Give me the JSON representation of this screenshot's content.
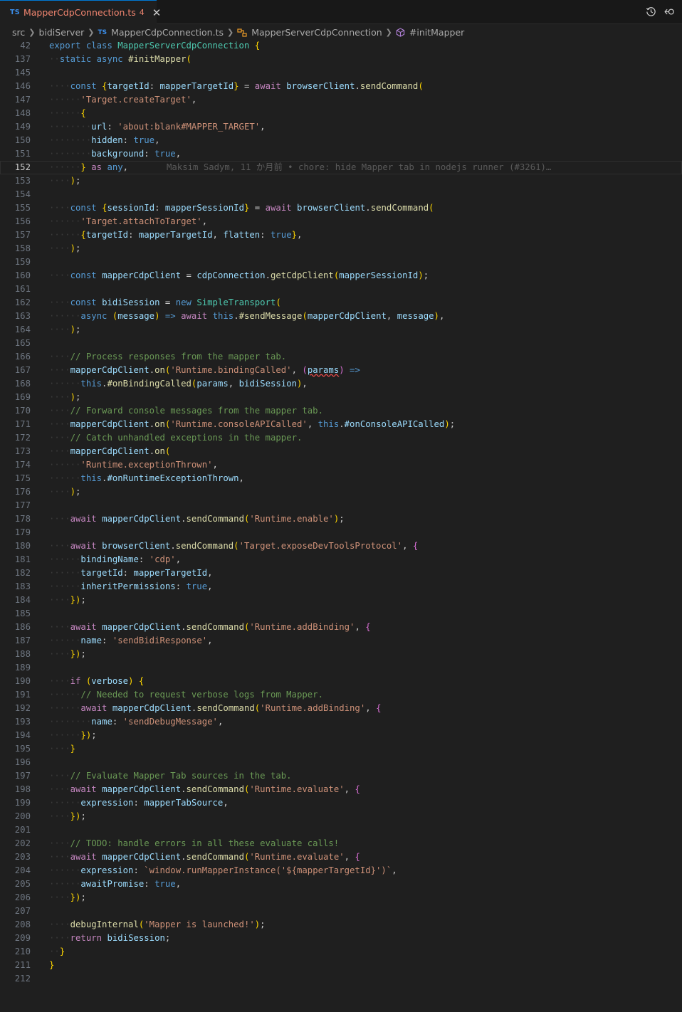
{
  "tab": {
    "lang_badge": "TS",
    "filename": "MapperCdpConnection.ts",
    "problem_count": "4",
    "close_glyph": "✕"
  },
  "toolbar": {
    "icons": [
      "history-icon",
      "go-back-icon"
    ]
  },
  "breadcrumb": {
    "items": [
      {
        "label": "src",
        "icon": ""
      },
      {
        "label": "bidiServer",
        "icon": ""
      },
      {
        "label": "MapperCdpConnection.ts",
        "icon": "typescript-file-icon"
      },
      {
        "label": "MapperServerCdpConnection",
        "icon": "class-icon"
      },
      {
        "label": "#initMapper",
        "icon": "method-icon"
      }
    ]
  },
  "editor": {
    "current_line": "152",
    "blame": "Maksim Sadym, 11 か月前 • chore: hide Mapper tab in nodejs runner (#3261)…",
    "lines": [
      {
        "n": "42",
        "t": "export class MapperServerCdpConnection {"
      },
      {
        "n": "137",
        "t": "  static async #initMapper("
      },
      {
        "n": "145",
        "t": ""
      },
      {
        "n": "146",
        "t": "    const {targetId: mapperTargetId} = await browserClient.sendCommand("
      },
      {
        "n": "147",
        "t": "      'Target.createTarget',"
      },
      {
        "n": "148",
        "t": "      {"
      },
      {
        "n": "149",
        "t": "        url: 'about:blank#MAPPER_TARGET',"
      },
      {
        "n": "150",
        "t": "        hidden: true,"
      },
      {
        "n": "151",
        "t": "        background: true,"
      },
      {
        "n": "152",
        "t": "      } as any,"
      },
      {
        "n": "153",
        "t": "    );"
      },
      {
        "n": "154",
        "t": ""
      },
      {
        "n": "155",
        "t": "    const {sessionId: mapperSessionId} = await browserClient.sendCommand("
      },
      {
        "n": "156",
        "t": "      'Target.attachToTarget',"
      },
      {
        "n": "157",
        "t": "      {targetId: mapperTargetId, flatten: true},"
      },
      {
        "n": "158",
        "t": "    );"
      },
      {
        "n": "159",
        "t": ""
      },
      {
        "n": "160",
        "t": "    const mapperCdpClient = cdpConnection.getCdpClient(mapperSessionId);"
      },
      {
        "n": "161",
        "t": ""
      },
      {
        "n": "162",
        "t": "    const bidiSession = new SimpleTransport("
      },
      {
        "n": "163",
        "t": "      async (message) => await this.#sendMessage(mapperCdpClient, message),"
      },
      {
        "n": "164",
        "t": "    );"
      },
      {
        "n": "165",
        "t": ""
      },
      {
        "n": "166",
        "t": "    // Process responses from the mapper tab."
      },
      {
        "n": "167",
        "t": "    mapperCdpClient.on('Runtime.bindingCalled', (params) =>"
      },
      {
        "n": "168",
        "t": "      this.#onBindingCalled(params, bidiSession),"
      },
      {
        "n": "169",
        "t": "    );"
      },
      {
        "n": "170",
        "t": "    // Forward console messages from the mapper tab."
      },
      {
        "n": "171",
        "t": "    mapperCdpClient.on('Runtime.consoleAPICalled', this.#onConsoleAPICalled);"
      },
      {
        "n": "172",
        "t": "    // Catch unhandled exceptions in the mapper."
      },
      {
        "n": "173",
        "t": "    mapperCdpClient.on("
      },
      {
        "n": "174",
        "t": "      'Runtime.exceptionThrown',"
      },
      {
        "n": "175",
        "t": "      this.#onRuntimeExceptionThrown,"
      },
      {
        "n": "176",
        "t": "    );"
      },
      {
        "n": "177",
        "t": ""
      },
      {
        "n": "178",
        "t": "    await mapperCdpClient.sendCommand('Runtime.enable');"
      },
      {
        "n": "179",
        "t": ""
      },
      {
        "n": "180",
        "t": "    await browserClient.sendCommand('Target.exposeDevToolsProtocol', {"
      },
      {
        "n": "181",
        "t": "      bindingName: 'cdp',"
      },
      {
        "n": "182",
        "t": "      targetId: mapperTargetId,"
      },
      {
        "n": "183",
        "t": "      inheritPermissions: true,"
      },
      {
        "n": "184",
        "t": "    });"
      },
      {
        "n": "185",
        "t": ""
      },
      {
        "n": "186",
        "t": "    await mapperCdpClient.sendCommand('Runtime.addBinding', {"
      },
      {
        "n": "187",
        "t": "      name: 'sendBidiResponse',"
      },
      {
        "n": "188",
        "t": "    });"
      },
      {
        "n": "189",
        "t": ""
      },
      {
        "n": "190",
        "t": "    if (verbose) {"
      },
      {
        "n": "191",
        "t": "      // Needed to request verbose logs from Mapper."
      },
      {
        "n": "192",
        "t": "      await mapperCdpClient.sendCommand('Runtime.addBinding', {"
      },
      {
        "n": "193",
        "t": "        name: 'sendDebugMessage',"
      },
      {
        "n": "194",
        "t": "      });"
      },
      {
        "n": "195",
        "t": "    }"
      },
      {
        "n": "196",
        "t": ""
      },
      {
        "n": "197",
        "t": "    // Evaluate Mapper Tab sources in the tab."
      },
      {
        "n": "198",
        "t": "    await mapperCdpClient.sendCommand('Runtime.evaluate', {"
      },
      {
        "n": "199",
        "t": "      expression: mapperTabSource,"
      },
      {
        "n": "200",
        "t": "    });"
      },
      {
        "n": "201",
        "t": ""
      },
      {
        "n": "202",
        "t": "    // TODO: handle errors in all these evaluate calls!"
      },
      {
        "n": "203",
        "t": "    await mapperCdpClient.sendCommand('Runtime.evaluate', {"
      },
      {
        "n": "204",
        "t": "      expression: `window.runMapperInstance('${mapperTargetId}')`,"
      },
      {
        "n": "205",
        "t": "      awaitPromise: true,"
      },
      {
        "n": "206",
        "t": "    });"
      },
      {
        "n": "207",
        "t": ""
      },
      {
        "n": "208",
        "t": "    debugInternal('Mapper is launched!');"
      },
      {
        "n": "209",
        "t": "    return bidiSession;"
      },
      {
        "n": "210",
        "t": "  }"
      },
      {
        "n": "211",
        "t": "}"
      },
      {
        "n": "212",
        "t": ""
      }
    ]
  },
  "colors": {
    "background": "#1f1f1f",
    "keyword": "#569cd6",
    "control": "#c586c0",
    "function": "#dcdcaa",
    "variable": "#9cdcfe",
    "string": "#ce9178",
    "type": "#4ec9b0",
    "comment": "#6a9955",
    "tab_error": "#f48771"
  }
}
